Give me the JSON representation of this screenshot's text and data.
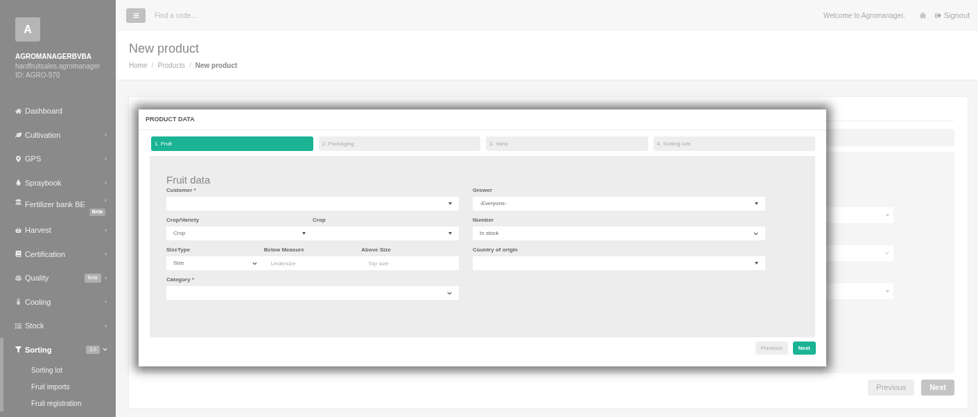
{
  "sidebar": {
    "avatar_letter": "A",
    "name": "AGROMANAGERBVBA",
    "domain": "hardfruitsales.agromanager",
    "account_id": "ID: AGRO-970",
    "items": [
      {
        "label": "Dashboard",
        "kind": "row",
        "selected": false
      },
      {
        "label": "Cultivation",
        "kind": "row",
        "expanded": false,
        "selected": false
      },
      {
        "label": "GPS",
        "kind": "row",
        "expanded": false,
        "selected": false
      },
      {
        "label": "Spraybook",
        "kind": "row",
        "expanded": false,
        "selected": false
      },
      {
        "label": "Fertilizer bank BE",
        "kind": "stacked",
        "badge": "Beta",
        "expanded": false,
        "selected": false
      },
      {
        "label": "Harvest",
        "kind": "row",
        "expanded": false,
        "selected": false
      },
      {
        "label": "Certification",
        "kind": "row",
        "expanded": false,
        "selected": false
      },
      {
        "label": "Quality",
        "kind": "row",
        "badge": "Beta",
        "expanded": false,
        "selected": false
      },
      {
        "label": "Cooling",
        "kind": "row",
        "expanded": false,
        "selected": false
      },
      {
        "label": "Stock",
        "kind": "row",
        "expanded": false,
        "selected": false
      },
      {
        "label": "Sorting",
        "kind": "row",
        "badge": "2.0",
        "expanded": true,
        "selected": true,
        "children": [
          {
            "label": "Sorting lot"
          },
          {
            "label": "Fruit imports"
          },
          {
            "label": "Fruit registration"
          }
        ]
      }
    ]
  },
  "topbar": {
    "search": {
      "placeholder": "Find a code..."
    },
    "welcome": "Welcome to Agromanager.",
    "signout": "Signout"
  },
  "page": {
    "title": "New product",
    "breadcrumb_separators": [
      "/",
      "/"
    ],
    "breadcrumbs": [
      {
        "label": "Home",
        "current": false
      },
      {
        "label": "Products",
        "current": false
      },
      {
        "label": "New product",
        "current": true
      }
    ],
    "buttons": [
      {
        "label": "Previous",
        "kind": "faint"
      },
      {
        "label": "Next",
        "kind": "grey"
      }
    ]
  },
  "modal": {
    "title": "PRODUCT DATA",
    "tabs": [
      {
        "label": "1. Fruit",
        "selected": true
      },
      {
        "label": "2. Packaging",
        "selected": false
      },
      {
        "label": "3. Varia",
        "selected": false
      },
      {
        "label": "4. Sorting lots",
        "selected": false
      }
    ],
    "form": {
      "title": "Fruit data",
      "rows": [
        {
          "left": [
            {
              "label": "Customer *",
              "kind": "select"
            }
          ],
          "right": [
            {
              "label": "Grower",
              "kind": "select",
              "value": "-Everyone-"
            }
          ]
        },
        {
          "left": [
            {
              "label": "Crop/Variety",
              "kind": "select",
              "value": "Crop"
            },
            {
              "label": "Crop",
              "kind": "select"
            }
          ],
          "right": [
            {
              "label": "Number",
              "kind": "dropdown",
              "value": "In stock"
            }
          ]
        },
        {
          "left": [
            {
              "label": "SizeType",
              "kind": "dropdown",
              "value": "Size"
            },
            {
              "label": "Below Measure",
              "kind": "input",
              "placeholder": "Undersize"
            },
            {
              "label": "Above Size",
              "kind": "input",
              "placeholder": "Top size"
            }
          ],
          "right": [
            {
              "label": "Country of origin",
              "kind": "select"
            }
          ]
        },
        {
          "left": [
            {
              "label": "Category *",
              "kind": "dropdown"
            }
          ],
          "right": []
        }
      ]
    },
    "buttons": [
      {
        "label": "Previous",
        "kind": "faint"
      },
      {
        "label": "Next",
        "kind": "primary"
      }
    ]
  }
}
